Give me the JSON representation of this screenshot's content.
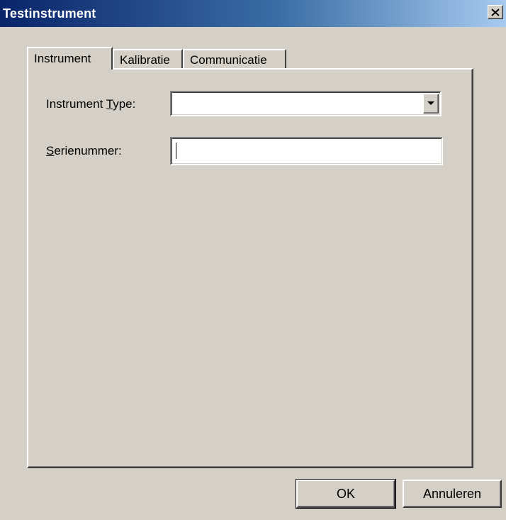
{
  "window": {
    "title": "Testinstrument",
    "close_icon": "close-icon"
  },
  "tabs": [
    {
      "label": "Instrument",
      "active": true
    },
    {
      "label": "Kalibratie",
      "active": false
    },
    {
      "label": "Communicatie",
      "active": false
    }
  ],
  "form": {
    "instrument_type": {
      "label_before": "Instrument ",
      "label_accel": "T",
      "label_after": "ype:",
      "value": "",
      "dropdown_icon": "chevron-down-icon"
    },
    "serienummer": {
      "label_accel": "S",
      "label_after": "erienummer:",
      "value": ""
    }
  },
  "buttons": {
    "ok_label": "OK",
    "cancel_label": "Annuleren"
  },
  "colors": {
    "titlebar_start": "#0a246a",
    "titlebar_end": "#a6caf0",
    "face": "#d4d0c8"
  }
}
